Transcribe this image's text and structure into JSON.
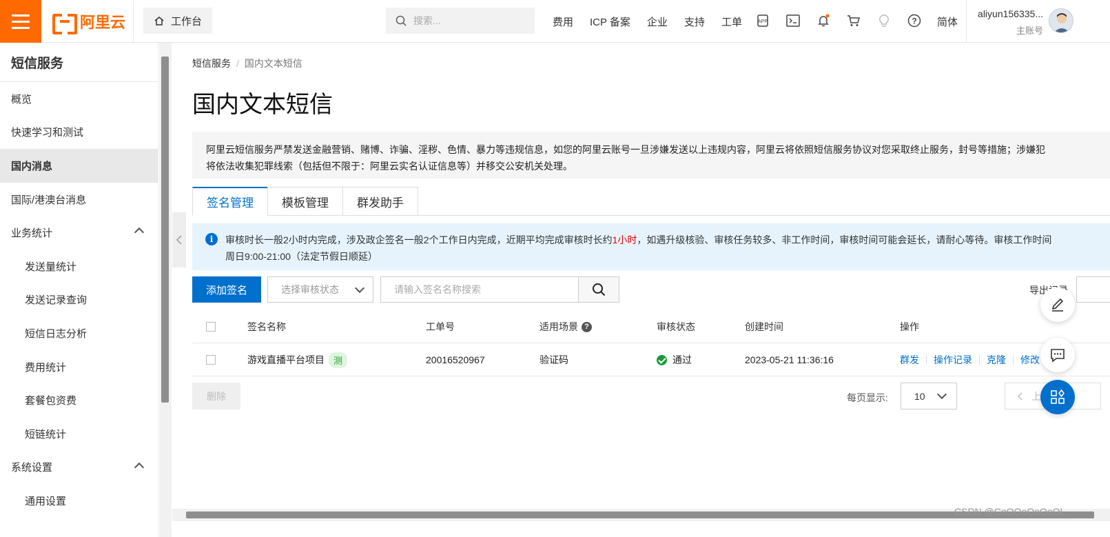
{
  "topbar": {
    "logo_text": "阿里云",
    "workbench_label": "工作台",
    "search_placeholder": "搜索...",
    "nav": [
      "费用",
      "ICP 备案",
      "企业",
      "支持",
      "工单"
    ],
    "lang": "简体",
    "user_name": "aliyun156335...",
    "user_role": "主账号",
    "icons": [
      "app-icon",
      "terminal-icon",
      "bell-icon",
      "cart-icon",
      "lightbulb-icon",
      "help-circle-icon"
    ],
    "brand_color": "#ff6a00"
  },
  "sidebar": {
    "title": "短信服务",
    "items": [
      {
        "label": "概览",
        "level": 1
      },
      {
        "label": "快速学习和测试",
        "level": 1
      },
      {
        "label": "国内消息",
        "level": 1,
        "active": true
      },
      {
        "label": "国际/港澳台消息",
        "level": 1
      },
      {
        "label": "业务统计",
        "level": 1,
        "expanded": true
      },
      {
        "label": "发送量统计",
        "level": 2
      },
      {
        "label": "发送记录查询",
        "level": 2
      },
      {
        "label": "短信日志分析",
        "level": 2
      },
      {
        "label": "费用统计",
        "level": 2
      },
      {
        "label": "套餐包资费",
        "level": 2
      },
      {
        "label": "短链统计",
        "level": 2
      },
      {
        "label": "系统设置",
        "level": 1,
        "expanded": true
      },
      {
        "label": "通用设置",
        "level": 2
      }
    ]
  },
  "breadcrumb": {
    "root": "短信服务",
    "sep": "/",
    "current": "国内文本短信"
  },
  "page_title": "国内文本短信",
  "warning": {
    "line1": "阿里云短信服务严禁发送金融营销、赌博、诈骗、淫秽、色情、暴力等违规信息，如您的阿里云账号一旦涉嫌发送以上违规内容，阿里云将依照短信服务协议对您采取终止服务，封号等措施；涉嫌犯",
    "line2": "将依法收集犯罪线索（包括但不限于：阿里云实名认证信息等）并移交公安机关处理。"
  },
  "tabs": [
    "签名管理",
    "模板管理",
    "群发助手"
  ],
  "notice": {
    "pre": "审核时长一般2小时内完成，涉及政企签名一般2个工作日内完成，近期平均完成审核时长约",
    "highlight": "1小时",
    "post": "，如遇升级核验、审核任务较多、非工作时间，审核时间可能会延长，请耐心等待。审核工作时间",
    "line2": "周日9:00-21:00（法定节假日顺延）",
    "accent_color": "#0070cc",
    "highlight_color": "#e00000"
  },
  "toolbar": {
    "add_label": "添加签名",
    "status_placeholder": "选择审核状态",
    "search_placeholder": "请输入签名名称搜索",
    "export_label": "导出记录"
  },
  "table": {
    "headers": {
      "name": "签名名称",
      "ticket": "工单号",
      "scene": "适用场景",
      "status": "审核状态",
      "created": "创建时间",
      "ops": "操作"
    },
    "rows": [
      {
        "name": "游戏直播平台项目",
        "badge": "测",
        "ticket": "20016520967",
        "scene": "验证码",
        "status": "通过",
        "created": "2023-05-21 11:36:16",
        "ops": [
          "群发",
          "操作记录",
          "克隆",
          "修改"
        ]
      }
    ]
  },
  "footer": {
    "delete_label": "删除",
    "perpage_label": "每页显示:",
    "perpage_value": "10",
    "prev_label": "上一页"
  },
  "watermark": "CSDN @CoOOoOoOoOL"
}
